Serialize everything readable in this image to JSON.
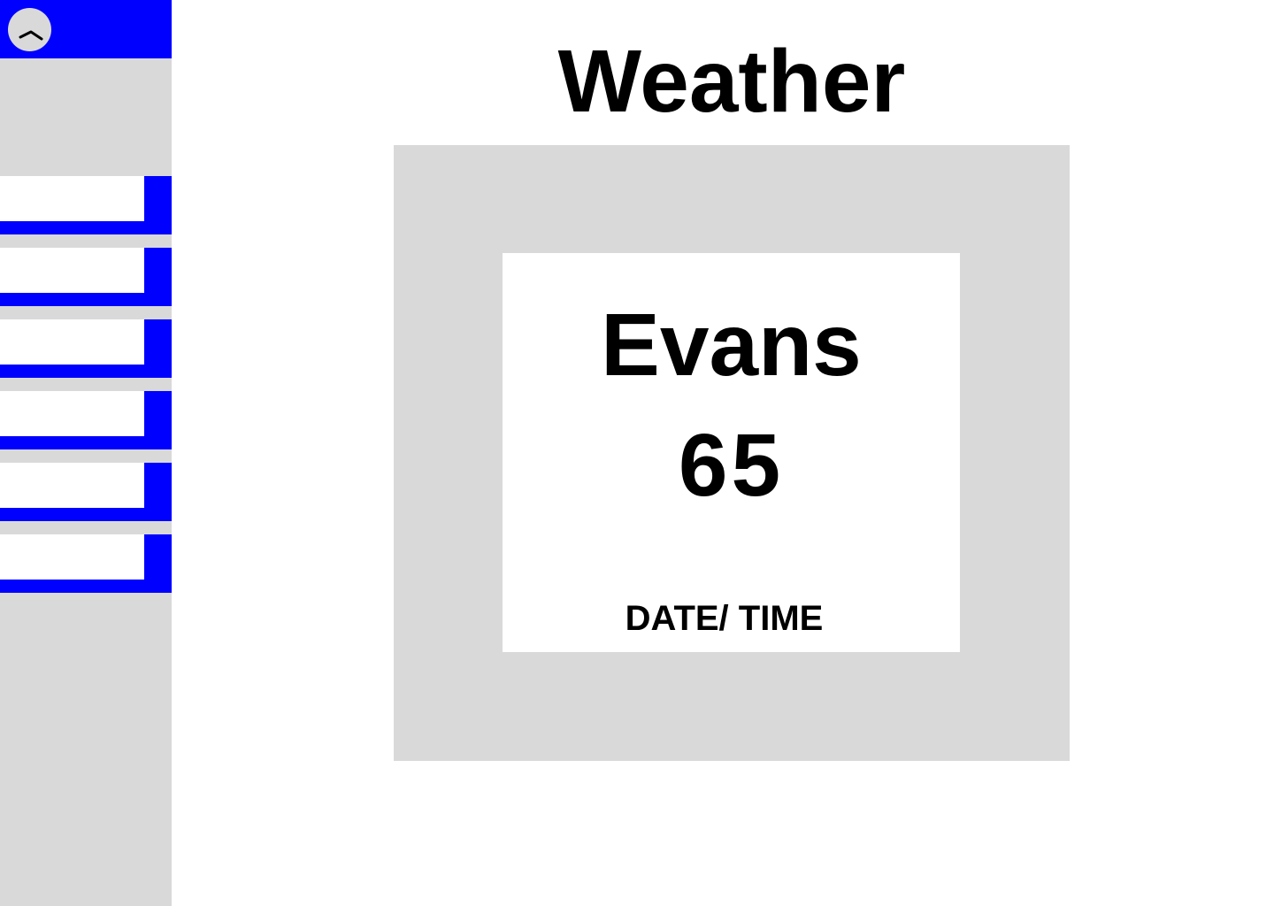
{
  "sidebar": {
    "accent_color": "#0000ff",
    "background_color": "#d9d9d9",
    "collapse_icon": "chevron-up-icon",
    "items": [
      {
        "label": ""
      },
      {
        "label": ""
      },
      {
        "label": ""
      },
      {
        "label": ""
      },
      {
        "label": ""
      },
      {
        "label": ""
      }
    ]
  },
  "main": {
    "title": "Weather",
    "card": {
      "location": "Evans",
      "temperature": "65",
      "datetime": "DATE/ TIME"
    }
  }
}
